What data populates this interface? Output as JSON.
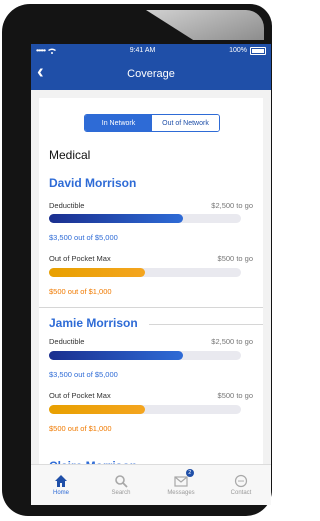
{
  "status_bar": {
    "carrier": "•••••",
    "time": "9:41 AM",
    "battery": "100%"
  },
  "nav": {
    "title": "Coverage"
  },
  "toggle": {
    "in_network": "In Network",
    "out_network": "Out of Network"
  },
  "section_title": "Medical",
  "members": [
    {
      "name": "David Morrison",
      "deductible_label": "Deductible",
      "deductible_to_go": "$2,500 to go",
      "deductible_amount": "$3,500 out of $5,000",
      "deductible_fraction": 0.7,
      "oop_label": "Out of Pocket Max",
      "oop_to_go": "$500 to go",
      "oop_amount": "$500 out of $1,000",
      "oop_fraction": 0.5
    },
    {
      "name": "Jamie Morrison",
      "deductible_label": "Deductible",
      "deductible_to_go": "$2,500 to go",
      "deductible_amount": "$3,500 out of $5,000",
      "deductible_fraction": 0.7,
      "oop_label": "Out of Pocket Max",
      "oop_to_go": "$500 to go",
      "oop_amount": "$500 out of $1,000",
      "oop_fraction": 0.5
    }
  ],
  "peek_member": "Claire Morrison",
  "tabs": [
    {
      "label": "Home",
      "icon": "home-icon"
    },
    {
      "label": "Search",
      "icon": "search-icon"
    },
    {
      "label": "Messages",
      "icon": "mail-icon",
      "badge": "2"
    },
    {
      "label": "Contact",
      "icon": "chat-icon"
    }
  ],
  "colors": {
    "primary": "#1f4fa8",
    "accent": "#2e6bd6",
    "orange": "#f4a51f"
  }
}
